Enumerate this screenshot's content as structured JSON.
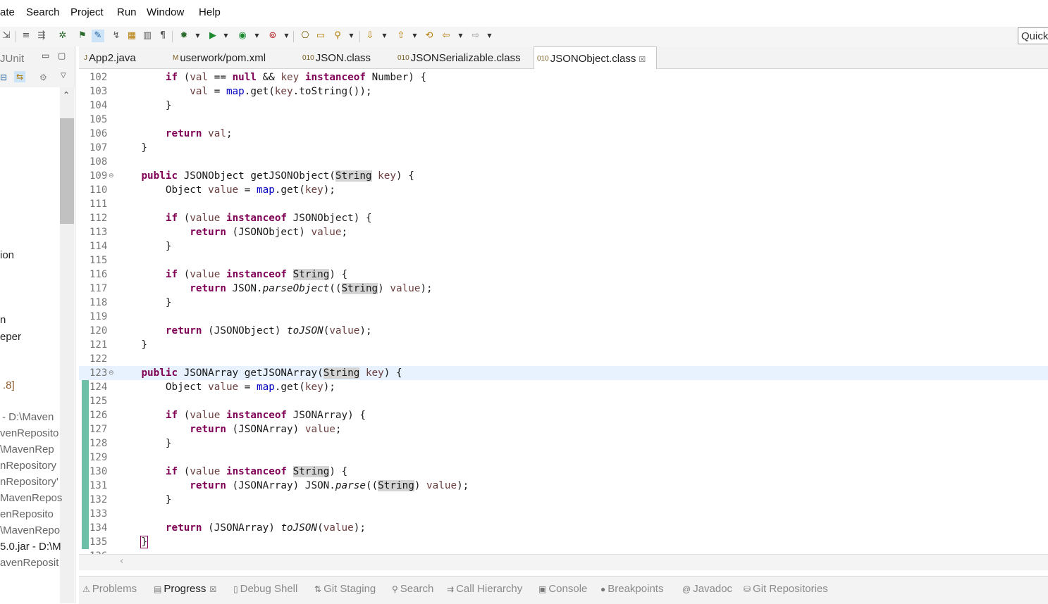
{
  "menu": [
    "ate",
    "Search",
    "Project",
    "Run",
    "Window",
    "Help"
  ],
  "quick_access": "Quick",
  "left_panel": {
    "title": "JUnit",
    "items": [
      {
        "text": "ion",
        "cls": ""
      },
      {
        "text": "n",
        "cls": ""
      },
      {
        "text": "eper",
        "cls": ""
      },
      {
        "text": ".8]",
        "cls": "brown"
      },
      {
        "text": "- D:\\Maven",
        "cls": "dim"
      },
      {
        "text": "venReposito",
        "cls": "dim"
      },
      {
        "text": "\\MavenRep",
        "cls": "dim"
      },
      {
        "text": "nRepository",
        "cls": "dim"
      },
      {
        "text": "nRepository'",
        "cls": "dim"
      },
      {
        "text": "MavenRepos",
        "cls": "dim"
      },
      {
        "text": "enReposito",
        "cls": "dim"
      },
      {
        "text": "\\MavenRepo",
        "cls": "dim"
      },
      {
        "text": "5.0.jar - D:\\M",
        "cls": "mixed"
      },
      {
        "text": "avenReposit",
        "cls": "dim"
      }
    ]
  },
  "editor_tabs": [
    {
      "label": "App2.java",
      "icon": "java-file-icon",
      "glyph": "J",
      "active": false
    },
    {
      "label": "userwork/pom.xml",
      "icon": "maven-pom-icon",
      "glyph": "M",
      "active": false
    },
    {
      "label": "JSON.class",
      "icon": "class-file-icon",
      "glyph": "010",
      "active": false
    },
    {
      "label": "JSONSerializable.class",
      "icon": "class-file-icon",
      "glyph": "010",
      "active": false
    },
    {
      "label": "JSONObject.class",
      "icon": "class-file-icon",
      "glyph": "010",
      "active": true
    }
  ],
  "code_lines": [
    {
      "n": "102",
      "html": "        <span class=\"kw\">if</span> (<span class=\"var\">val</span> == <span class=\"kw\">null</span> &amp;&amp; <span class=\"var\">key</span> <span class=\"kw\">instanceof</span> Number) {"
    },
    {
      "n": "103",
      "html": "            <span class=\"var\">val</span> = <span class=\"fld\">map</span>.get(<span class=\"var\">key</span>.toString());"
    },
    {
      "n": "104",
      "html": "        }"
    },
    {
      "n": "105",
      "html": ""
    },
    {
      "n": "106",
      "html": "        <span class=\"kw\">return</span> <span class=\"var\">val</span>;"
    },
    {
      "n": "107",
      "html": "    }"
    },
    {
      "n": "108",
      "html": ""
    },
    {
      "n": "109",
      "fold": true,
      "html": "    <span class=\"kw\">public</span> JSONObject getJSONObject(<span class=\"hl\">String</span> <span class=\"var\">key</span>) {"
    },
    {
      "n": "110",
      "html": "        Object <span class=\"var\">value</span> = <span class=\"fld\">map</span>.get(<span class=\"var\">key</span>);"
    },
    {
      "n": "111",
      "html": ""
    },
    {
      "n": "112",
      "html": "        <span class=\"kw\">if</span> (<span class=\"var\">value</span> <span class=\"kw\">instanceof</span> JSONObject) {"
    },
    {
      "n": "113",
      "html": "            <span class=\"kw\">return</span> (JSONObject) <span class=\"var\">value</span>;"
    },
    {
      "n": "114",
      "html": "        }"
    },
    {
      "n": "115",
      "html": ""
    },
    {
      "n": "116",
      "html": "        <span class=\"kw\">if</span> (<span class=\"var\">value</span> <span class=\"kw\">instanceof</span> <span class=\"hl\">String</span>) {"
    },
    {
      "n": "117",
      "html": "            <span class=\"kw\">return</span> JSON.<span class=\"ital\">parseObject</span>((<span class=\"hl\">String</span>) <span class=\"var\">value</span>);"
    },
    {
      "n": "118",
      "html": "        }"
    },
    {
      "n": "119",
      "html": ""
    },
    {
      "n": "120",
      "html": "        <span class=\"kw\">return</span> (JSONObject) <span class=\"ital\">toJSON</span>(<span class=\"var\">value</span>);"
    },
    {
      "n": "121",
      "html": "    }"
    },
    {
      "n": "122",
      "html": ""
    },
    {
      "n": "123",
      "fold": true,
      "current": true,
      "html": "    <span class=\"kw\">public</span> JSONArray getJSONArray(<span class=\"hl\">String</span> <span class=\"var\">key</span>) {"
    },
    {
      "n": "124",
      "html": "        Object <span class=\"var\">value</span> = <span class=\"fld\">map</span>.get(<span class=\"var\">key</span>);"
    },
    {
      "n": "125",
      "html": ""
    },
    {
      "n": "126",
      "html": "        <span class=\"kw\">if</span> (<span class=\"var\">value</span> <span class=\"kw\">instanceof</span> JSONArray) {"
    },
    {
      "n": "127",
      "html": "            <span class=\"kw\">return</span> (JSONArray) <span class=\"var\">value</span>;"
    },
    {
      "n": "128",
      "html": "        }"
    },
    {
      "n": "129",
      "html": ""
    },
    {
      "n": "130",
      "html": "        <span class=\"kw\">if</span> (<span class=\"var\">value</span> <span class=\"kw\">instanceof</span> <span class=\"hl\">String</span>) {"
    },
    {
      "n": "131",
      "html": "            <span class=\"kw\">return</span> (JSONArray) JSON.<span class=\"ital\">parse</span>((<span class=\"hl\">String</span>) <span class=\"var\">value</span>);"
    },
    {
      "n": "132",
      "html": "        }"
    },
    {
      "n": "133",
      "html": ""
    },
    {
      "n": "134",
      "html": "        <span class=\"kw\">return</span> (JSONArray) <span class=\"ital\">toJSON</span>(<span class=\"var\">value</span>);"
    },
    {
      "n": "135",
      "html": "    <span class=\"brk\">}</span>"
    },
    {
      "n": "136",
      "html": ""
    }
  ],
  "bottom_tabs": [
    {
      "label": "Problems",
      "icon": "problems-icon",
      "glyph": "⚠",
      "active": false
    },
    {
      "label": "Progress",
      "icon": "progress-icon",
      "glyph": "▤",
      "active": true
    },
    {
      "label": "Debug Shell",
      "icon": "debug-shell-icon",
      "glyph": "▯",
      "active": false
    },
    {
      "label": "Git Staging",
      "icon": "git-staging-icon",
      "glyph": "⇅",
      "active": false
    },
    {
      "label": "Search",
      "icon": "search-icon",
      "glyph": "⚲",
      "active": false
    },
    {
      "label": "Call Hierarchy",
      "icon": "call-hierarchy-icon",
      "glyph": "⇉",
      "active": false
    },
    {
      "label": "Console",
      "icon": "console-icon",
      "glyph": "▣",
      "active": false
    },
    {
      "label": "Breakpoints",
      "icon": "breakpoints-icon",
      "glyph": "●",
      "active": false
    },
    {
      "label": "Javadoc",
      "icon": "javadoc-icon",
      "glyph": "@",
      "active": false
    },
    {
      "label": "Git Repositories",
      "icon": "git-repositories-icon",
      "glyph": "⛁",
      "active": false
    }
  ]
}
